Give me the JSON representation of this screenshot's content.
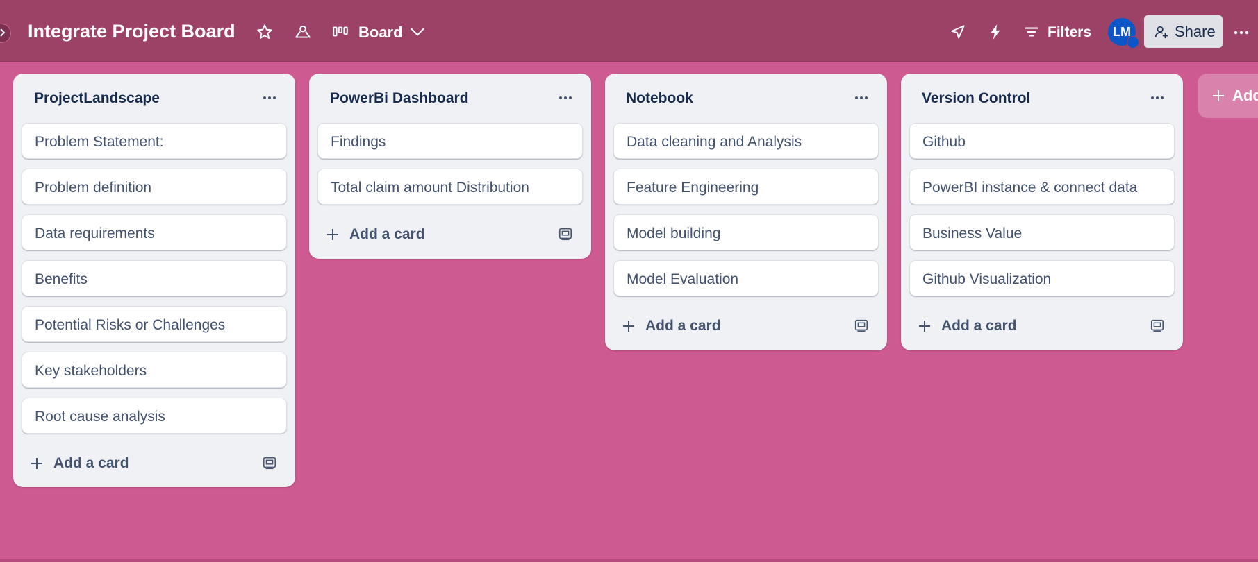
{
  "board": {
    "title": "Integrate Project Board",
    "view_label": "Board",
    "filters_label": "Filters",
    "avatar_initials": "LM",
    "share_label": "Share",
    "colors": {
      "background": "#cd5a91",
      "topbar": "#9c4267",
      "avatar": "#0c56c7"
    }
  },
  "lists": [
    {
      "title": "ProjectLandscape",
      "cards": [
        "Problem Statement:",
        "Problem definition",
        "Data requirements",
        "Benefits",
        "Potential Risks or Challenges",
        "Key stakeholders",
        "Root cause analysis"
      ],
      "add_card_label": "Add a card"
    },
    {
      "title": "PowerBi Dashboard",
      "cards": [
        "Findings",
        "Total claim amount Distribution"
      ],
      "add_card_label": "Add a card"
    },
    {
      "title": "Notebook",
      "cards": [
        "Data cleaning and Analysis",
        "Feature Engineering",
        "Model building",
        "Model Evaluation"
      ],
      "add_card_label": "Add a card"
    },
    {
      "title": "Version Control",
      "cards": [
        "Github",
        "PowerBI instance & connect data",
        "Business Value",
        "Github Visualization"
      ],
      "add_card_label": "Add a card"
    }
  ],
  "add_list_label": "Add",
  "icons": [
    "chevron-right-icon",
    "star-icon",
    "workspace-visibility-icon",
    "board-view-icon",
    "chevron-down-icon",
    "power-ups-icon",
    "automation-icon",
    "filter-icon",
    "share-user-icon",
    "more-icon",
    "plus-icon",
    "template-icon"
  ]
}
